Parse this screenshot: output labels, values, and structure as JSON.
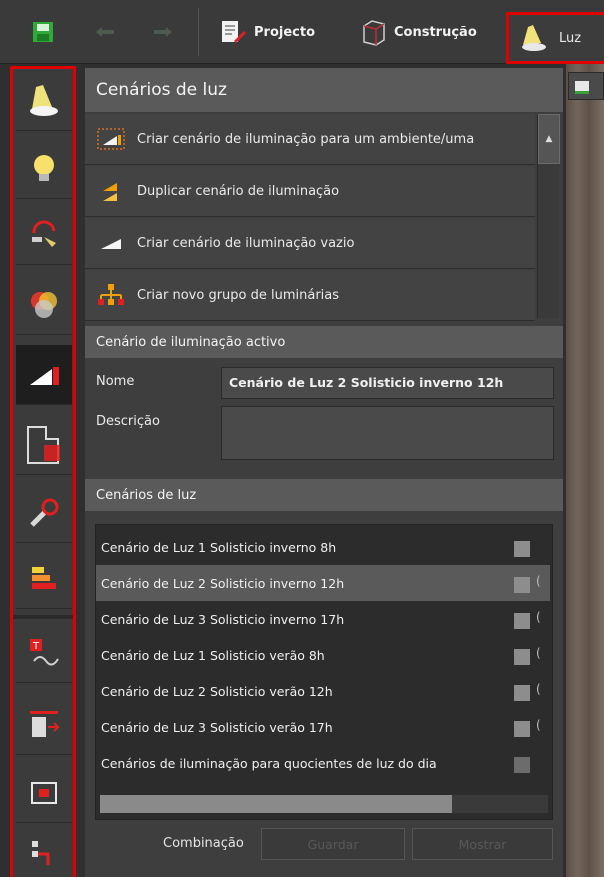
{
  "toolbar": {
    "projecto": "Projecto",
    "construcao": "Construção",
    "luz": "Luz"
  },
  "panel": {
    "title": "Cenários de luz",
    "actions": [
      {
        "label": "Criar cenário de iluminação para um ambiente/uma",
        "icon": "create-scenario-room-icon"
      },
      {
        "label": "Duplicar cenário de iluminação",
        "icon": "duplicate-scenario-icon"
      },
      {
        "label": "Criar cenário de iluminação vazio",
        "icon": "empty-scenario-icon"
      },
      {
        "label": "Criar novo grupo de luminárias",
        "icon": "luminaire-group-icon"
      }
    ],
    "active": {
      "title": "Cenário de iluminação activo",
      "name_label": "Nome",
      "name_value": "Cenário de Luz 2 Solisticio inverno 12h",
      "desc_label": "Descrição",
      "desc_value": ""
    },
    "scenarios": {
      "title": "Cenários de luz",
      "items": [
        {
          "label": "Cenário de Luz 1 Solisticio inverno 8h",
          "paren": ""
        },
        {
          "label": "Cenário de Luz 2 Solisticio inverno 12h",
          "paren": "("
        },
        {
          "label": "Cenário de Luz 3 Solisticio inverno 17h",
          "paren": "("
        },
        {
          "label": "Cenário de Luz 1 Solisticio verão 8h",
          "paren": "("
        },
        {
          "label": "Cenário de Luz 2 Solisticio verão 12h",
          "paren": "("
        },
        {
          "label": "Cenário de Luz 3 Solisticio verão 17h",
          "paren": "("
        },
        {
          "label": "Cenários de iluminação para quocientes de luz do dia",
          "paren": ""
        }
      ],
      "selected_index": 1
    },
    "combination_label": "Combinação",
    "save_label": "Guardar",
    "show_label": "Mostrar"
  },
  "colors": {
    "highlight": "#e00000",
    "accent_orange": "#f0a000",
    "accent_red": "#e02020"
  }
}
